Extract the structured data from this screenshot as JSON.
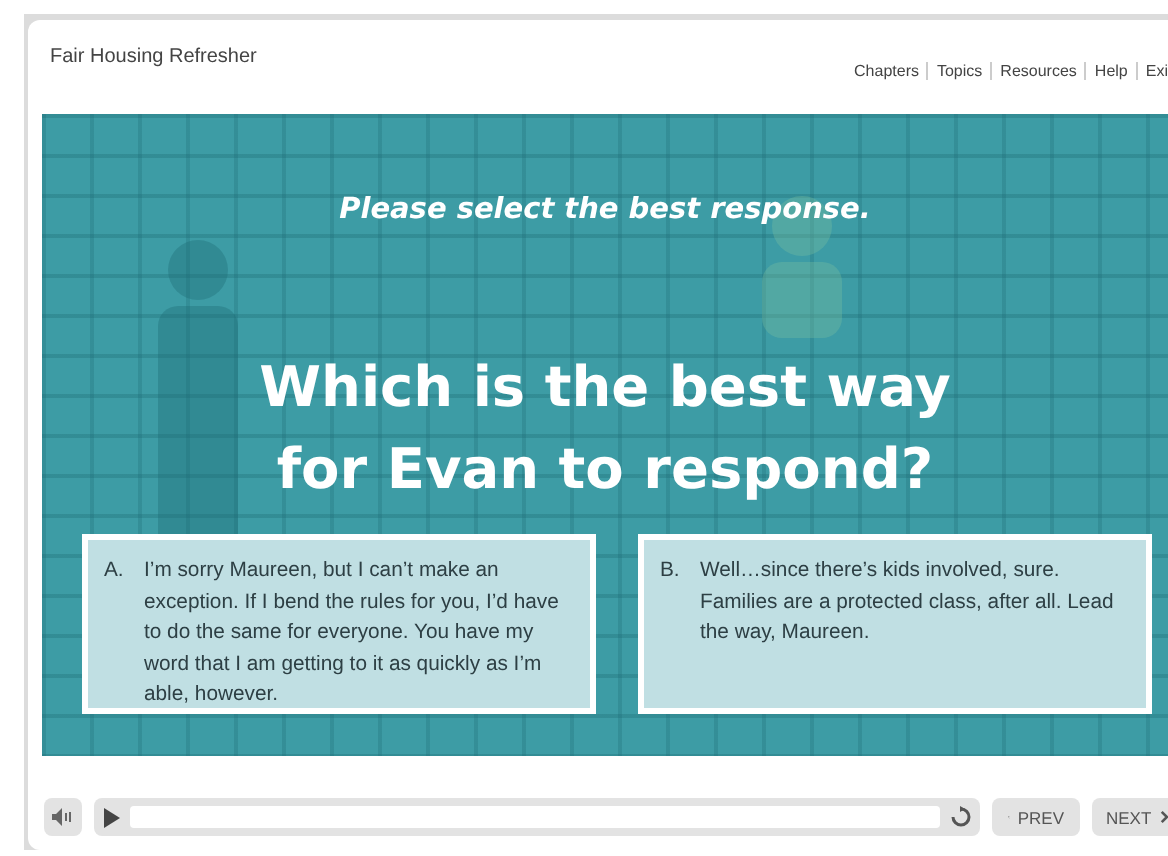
{
  "header": {
    "title": "Fair Housing Refresher",
    "nav": [
      "Chapters",
      "Topics",
      "Resources",
      "Help",
      "Exi"
    ]
  },
  "slide": {
    "prompt": "Please select the best response.",
    "question": "Which is the best way for Evan to respond?",
    "answers": [
      {
        "letter": "A.",
        "text": "I’m sorry Maureen, but I can’t make an exception. If I bend the rules for you, I’d have to do the same for everyone. You have my word that I am getting to it as quickly as I’m able, however."
      },
      {
        "letter": "B.",
        "text": "Well…since there’s kids involved, sure. Families are a protected class, after all. Lead the way, Maureen."
      }
    ]
  },
  "player": {
    "prev": "PREV",
    "next": "NEXT"
  }
}
